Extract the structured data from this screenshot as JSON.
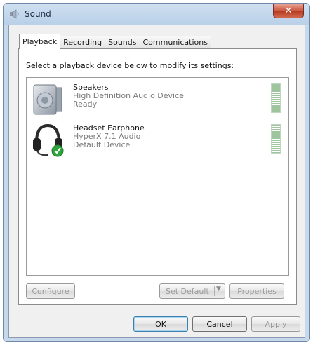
{
  "window": {
    "title": "Sound",
    "close_label": "✕"
  },
  "tabs": [
    {
      "label": "Playback",
      "active": true
    },
    {
      "label": "Recording",
      "active": false
    },
    {
      "label": "Sounds",
      "active": false
    },
    {
      "label": "Communications",
      "active": false
    }
  ],
  "panel": {
    "instruction": "Select a playback device below to modify its settings:",
    "devices": [
      {
        "name": "Speakers",
        "driver": "High Definition Audio Device",
        "status": "Ready",
        "icon": "speaker-icon"
      },
      {
        "name": "Headset Earphone",
        "driver": "HyperX 7.1 Audio",
        "status": "Default Device",
        "icon": "headset-icon",
        "badge": "green-check-icon"
      }
    ],
    "buttons": {
      "configure": "Configure",
      "set_default": "Set Default",
      "properties": "Properties"
    }
  },
  "footer": {
    "ok": "OK",
    "cancel": "Cancel",
    "apply": "Apply"
  },
  "colors": {
    "titlebar": "#b9d0e8",
    "close": "#c8553d",
    "level_meter": "#9ec59e",
    "default_check": "#2fa33c"
  }
}
